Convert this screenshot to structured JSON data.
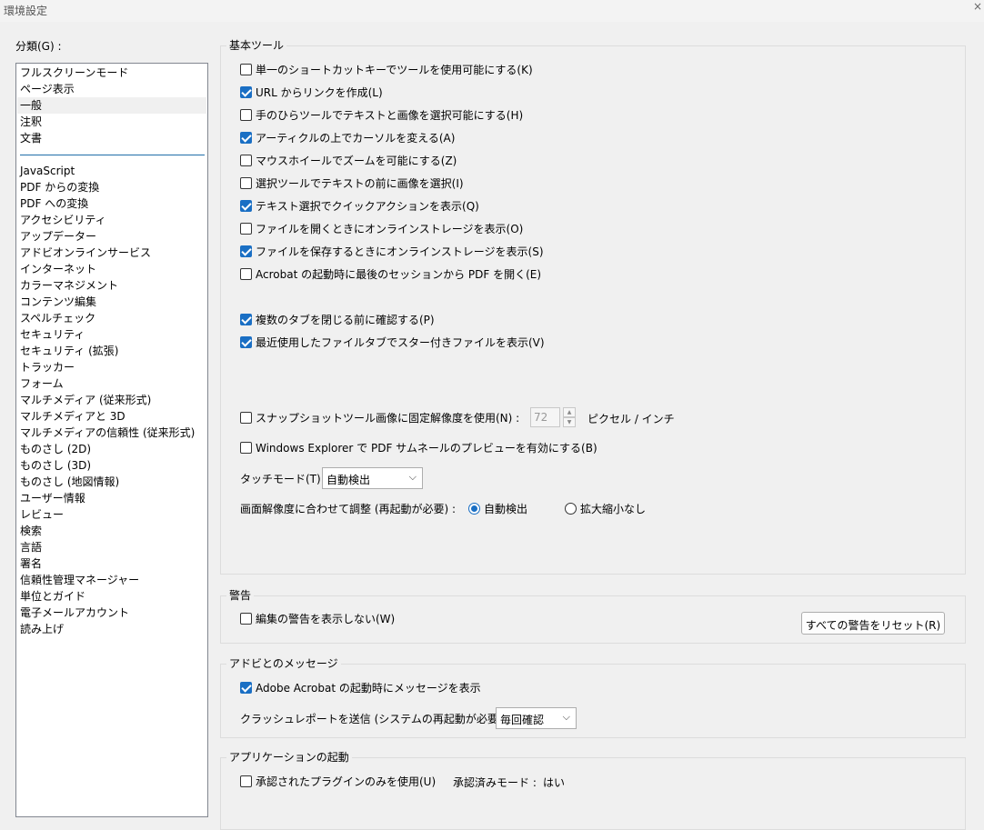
{
  "window": {
    "title": "環境設定",
    "close_glyph": "×"
  },
  "categories": {
    "label": "分類(G) :",
    "top_items": [
      "フルスクリーンモード",
      "ページ表示",
      "一般",
      "注釈",
      "文書"
    ],
    "selected_index": 2,
    "items": [
      "JavaScript",
      "PDF からの変換",
      "PDF への変換",
      "アクセシビリティ",
      "アップデーター",
      "アドビオンラインサービス",
      "インターネット",
      "カラーマネジメント",
      "コンテンツ編集",
      "スペルチェック",
      "セキュリティ",
      "セキュリティ (拡張)",
      "トラッカー",
      "フォーム",
      "マルチメディア (従来形式)",
      "マルチメディアと 3D",
      "マルチメディアの信頼性 (従来形式)",
      "ものさし (2D)",
      "ものさし (3D)",
      "ものさし (地図情報)",
      "ユーザー情報",
      "レビュー",
      "検索",
      "言語",
      "署名",
      "信頼性管理マネージャー",
      "単位とガイド",
      "電子メールアカウント",
      "読み上げ"
    ]
  },
  "basic_tools": {
    "title": "基本ツール",
    "options": [
      {
        "label": "単一のショートカットキーでツールを使用可能にする(K)",
        "checked": false
      },
      {
        "label": "URL からリンクを作成(L)",
        "checked": true
      },
      {
        "label": "手のひらツールでテキストと画像を選択可能にする(H)",
        "checked": false
      },
      {
        "label": "アーティクルの上でカーソルを変える(A)",
        "checked": true
      },
      {
        "label": "マウスホイールでズームを可能にする(Z)",
        "checked": false
      },
      {
        "label": "選択ツールでテキストの前に画像を選択(I)",
        "checked": false
      },
      {
        "label": "テキスト選択でクイックアクションを表示(Q)",
        "checked": true
      },
      {
        "label": "ファイルを開くときにオンラインストレージを表示(O)",
        "checked": false
      },
      {
        "label": "ファイルを保存するときにオンラインストレージを表示(S)",
        "checked": true
      },
      {
        "label": "Acrobat の起動時に最後のセッションから PDF を開く(E)",
        "checked": false
      }
    ],
    "tab_options": [
      {
        "label": "複数のタブを閉じる前に確認する(P)",
        "checked": true
      },
      {
        "label": "最近使用したファイルタブでスター付きファイルを表示(V)",
        "checked": true
      }
    ],
    "snapshot": {
      "label": "スナップショットツール画像に固定解像度を使用(N) :",
      "checked": false,
      "value": "72",
      "unit": "ピクセル / インチ"
    },
    "thumbnail": {
      "label": "Windows Explorer で PDF サムネールのプレビューを有効にする(B)",
      "checked": false
    },
    "touch_mode": {
      "label": "タッチモード(T) :",
      "value": "自動検出"
    },
    "scaling": {
      "label": "画面解像度に合わせて調整 (再起動が必要) :",
      "option_auto": "自動検出",
      "option_none": "拡大縮小なし",
      "selected": "auto"
    }
  },
  "warnings": {
    "title": "警告",
    "option": {
      "label": "編集の警告を表示しない(W)",
      "checked": false
    },
    "reset_button": "すべての警告をリセット(R)"
  },
  "adobe_messages": {
    "title": "アドビとのメッセージ",
    "option": {
      "label": "Adobe Acrobat の起動時にメッセージを表示",
      "checked": true
    },
    "crash_label": "クラッシュレポートを送信 (システムの再起動が必要):",
    "crash_value": "毎回確認"
  },
  "app_startup": {
    "title": "アプリケーションの起動",
    "option": {
      "label": "承認されたプラグインのみを使用(U)",
      "checked": false
    },
    "approved_mode_label": "承認済みモード :",
    "approved_mode_value": "はい"
  }
}
